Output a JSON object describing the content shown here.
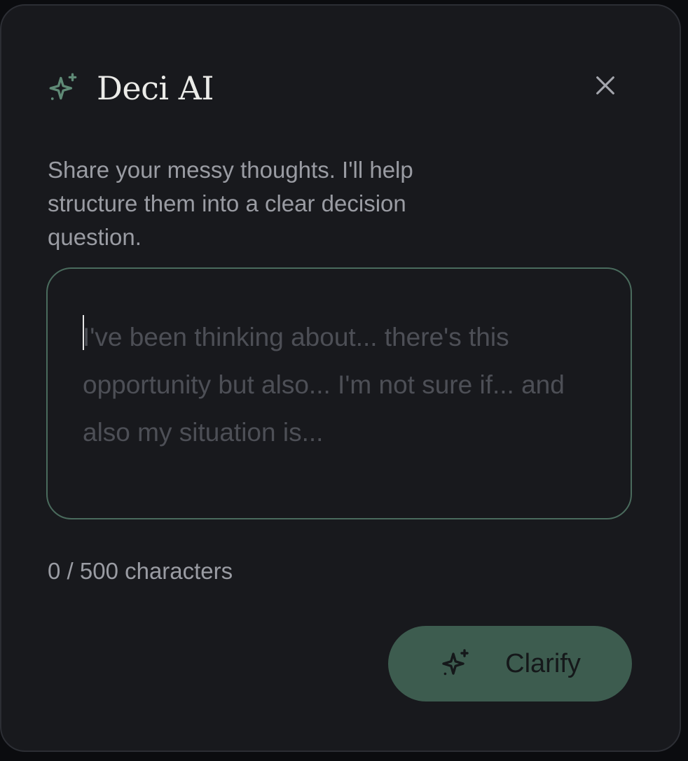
{
  "colors": {
    "page_background": "#0b0c0f",
    "modal_background": "#18191d",
    "accent": "#5f8a76",
    "input_border": "#4a6b5d",
    "button_background": "#3d5c4f",
    "muted_text": "#9a9ca3",
    "placeholder_text": "#4d4f56"
  },
  "header": {
    "icon": "sparkles-icon",
    "title": "Deci AI",
    "close_icon": "close-icon"
  },
  "intro": {
    "text": "Share your messy thoughts. I'll help structure them into a clear decision question."
  },
  "thoughts_input": {
    "value": "",
    "placeholder": "I've been thinking about... there's this opportunity but also... I'm not sure if... and also my situation is..."
  },
  "char_counter": {
    "text": "0 / 500 characters"
  },
  "clarify_button": {
    "icon": "sparkles-icon",
    "label": "Clarify"
  }
}
